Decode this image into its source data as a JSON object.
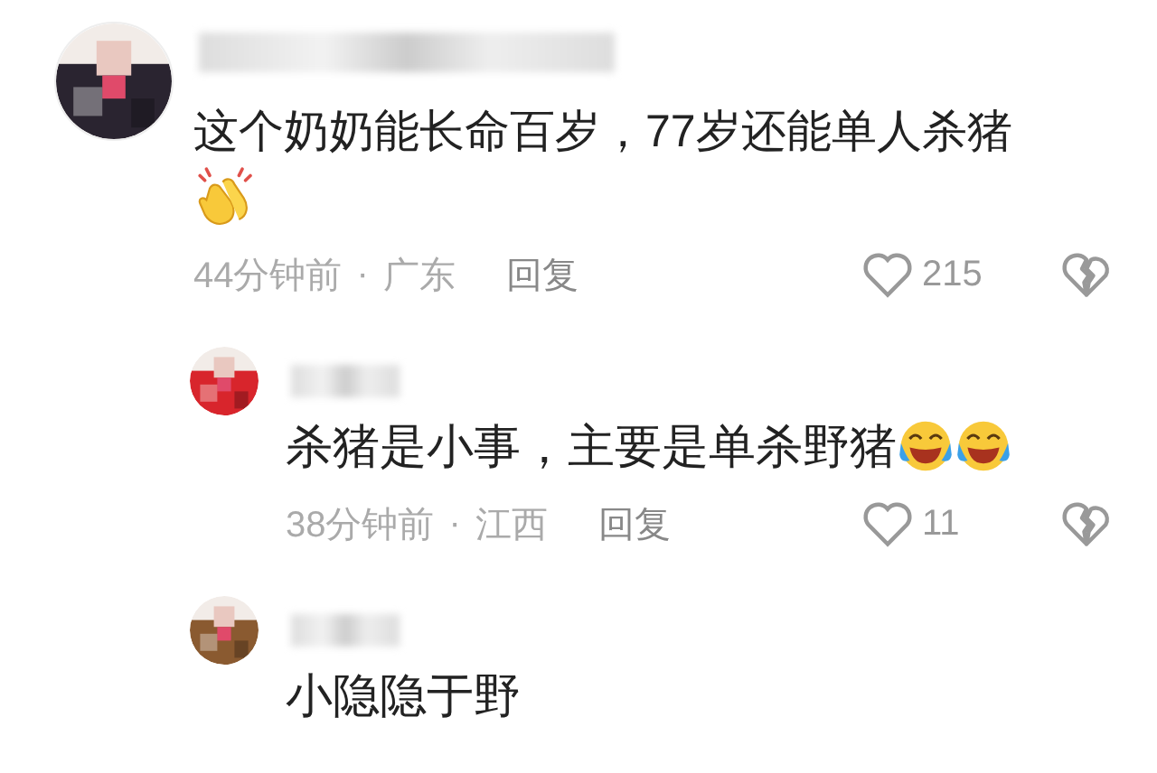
{
  "comments": [
    {
      "text": "这个奶奶能长命百岁，77岁还能单人杀猪",
      "emoji_line": [
        {
          "kind": "clap"
        }
      ],
      "time": "44分钟前",
      "separator": "·",
      "region": "广东",
      "reply_label": "回复",
      "likes": "215",
      "children": [
        {
          "text": "杀猪是小事，主要是单杀野猪",
          "inline_emojis": [
            {
              "kind": "laugh"
            },
            {
              "kind": "laugh"
            }
          ],
          "time": "38分钟前",
          "separator": "·",
          "region": "江西",
          "reply_label": "回复",
          "likes": "11"
        },
        {
          "text": "小隐隐于野"
        }
      ]
    }
  ]
}
